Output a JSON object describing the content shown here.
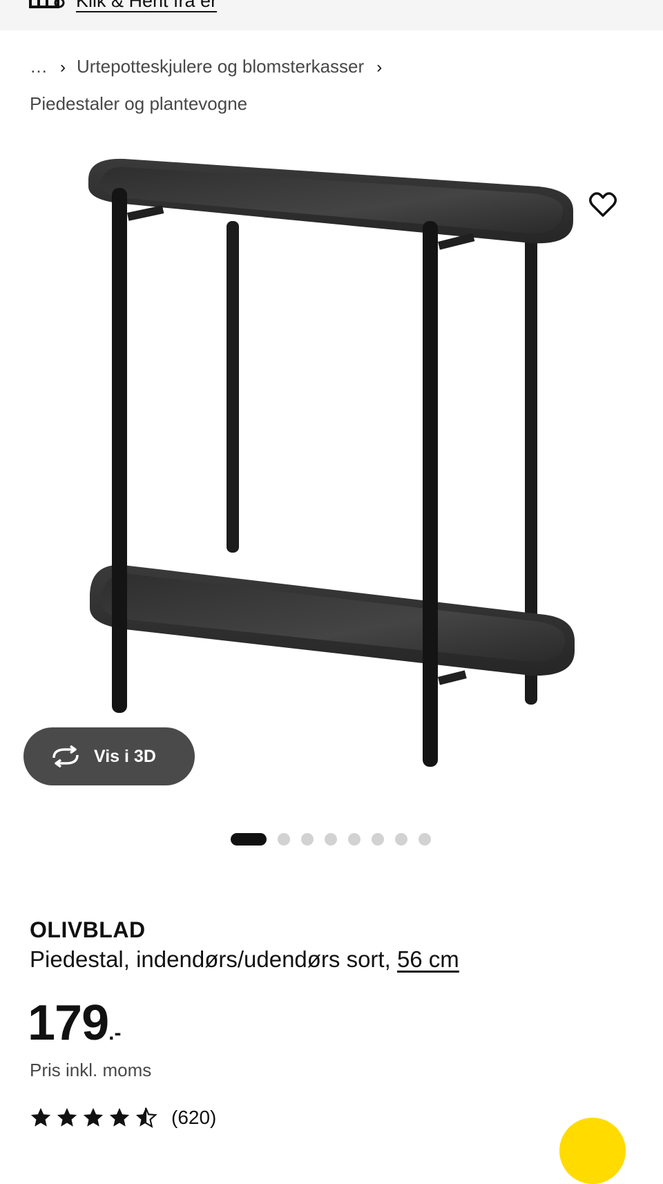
{
  "topbar": {
    "store_link": "Klik & Hent fra er"
  },
  "breadcrumb": {
    "ellipsis": "…",
    "items": [
      "Urtepotteskjulere og blomsterkasser",
      "Piedestaler og plantevogne"
    ]
  },
  "gallery": {
    "view3d_label": "Vis i 3D",
    "image_count": 8,
    "active_index": 0
  },
  "product": {
    "name": "OLIVBLAD",
    "description": "Piedestal, indendørs/udendørs sort, ",
    "size_link": "56 cm",
    "price_amount": "179",
    "price_suffix": ".-",
    "price_note": "Pris inkl. moms",
    "rating": 4.5,
    "review_count": "(620)"
  },
  "colors": {
    "accent_yellow": "#ffdb00",
    "button_dark": "#4a4a4a"
  }
}
